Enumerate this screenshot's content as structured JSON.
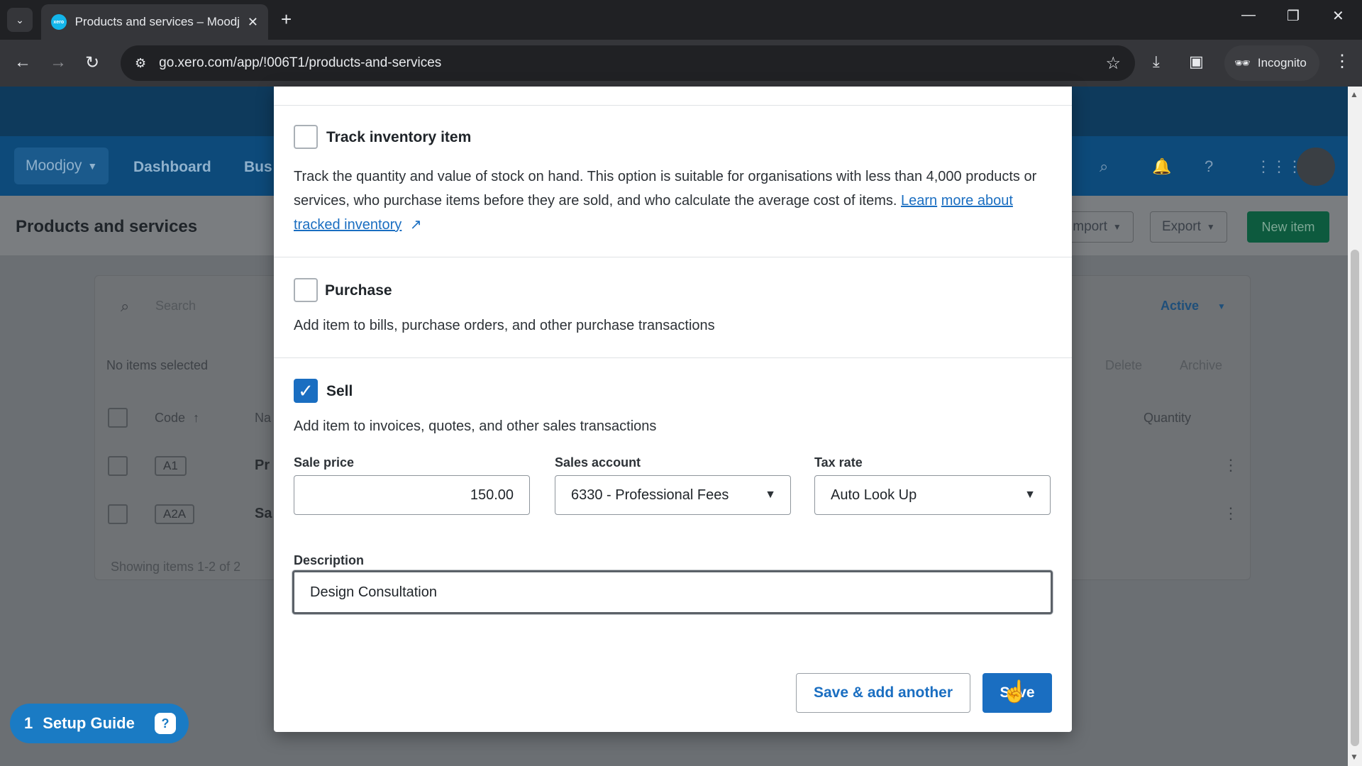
{
  "browser": {
    "tab_title": "Products and services – Moodjoy",
    "url": "go.xero.com/app/!006T1/products-and-services",
    "incognito_label": "Incognito",
    "icons": [
      "tab-list-icon",
      "xero-favicon",
      "close-icon",
      "plus-icon",
      "minimize-icon",
      "restore-icon",
      "window-close-icon",
      "back-icon",
      "forward-icon",
      "reload-icon",
      "site-info-icon",
      "star-icon",
      "download-icon",
      "sidepanel-icon",
      "incognito-icon",
      "menu-dots-icon"
    ]
  },
  "app": {
    "org_name": "Moodjoy",
    "nav": [
      "Dashboard",
      "Bus"
    ],
    "page_title": "Products and services",
    "header_buttons": {
      "import": "Import",
      "export": "Export",
      "new_item": "New item"
    },
    "list": {
      "search_placeholder": "Search",
      "status_filter": "Active",
      "selection_text": "No items selected",
      "delete": "Delete",
      "archive": "Archive",
      "col_code": "Code",
      "col_name": "Na",
      "col_quantity": "Quantity",
      "rows": [
        {
          "code": "A1",
          "name": "Pr"
        },
        {
          "code": "A2A",
          "name": "Sa"
        }
      ],
      "footer": "Showing items 1-2 of 2"
    },
    "setup_guide": {
      "count": "1",
      "label": "Setup Guide"
    }
  },
  "modal": {
    "track": {
      "label": "Track inventory item",
      "desc": "Track the quantity and value of stock on hand. This option is suitable for organisations with less than 4,000 products or services, who purchase items before they are sold, and who calculate the average cost of items.",
      "link_part1": "Learn",
      "link_part2": "more about tracked inventory",
      "checked": false
    },
    "purchase": {
      "label": "Purchase",
      "desc": "Add item to bills, purchase orders, and other purchase transactions",
      "checked": false
    },
    "sell": {
      "label": "Sell",
      "desc": "Add item to invoices, quotes, and other sales transactions",
      "checked": true,
      "sale_price_label": "Sale price",
      "sale_price": "150.00",
      "sales_account_label": "Sales account",
      "sales_account": "6330 - Professional Fees",
      "tax_rate_label": "Tax rate",
      "tax_rate": "Auto Look Up",
      "description_label": "Description",
      "description": "Design Consultation"
    },
    "buttons": {
      "save_add_another": "Save & add another",
      "save": "Save"
    },
    "accent_color": "#1a6ec1"
  }
}
